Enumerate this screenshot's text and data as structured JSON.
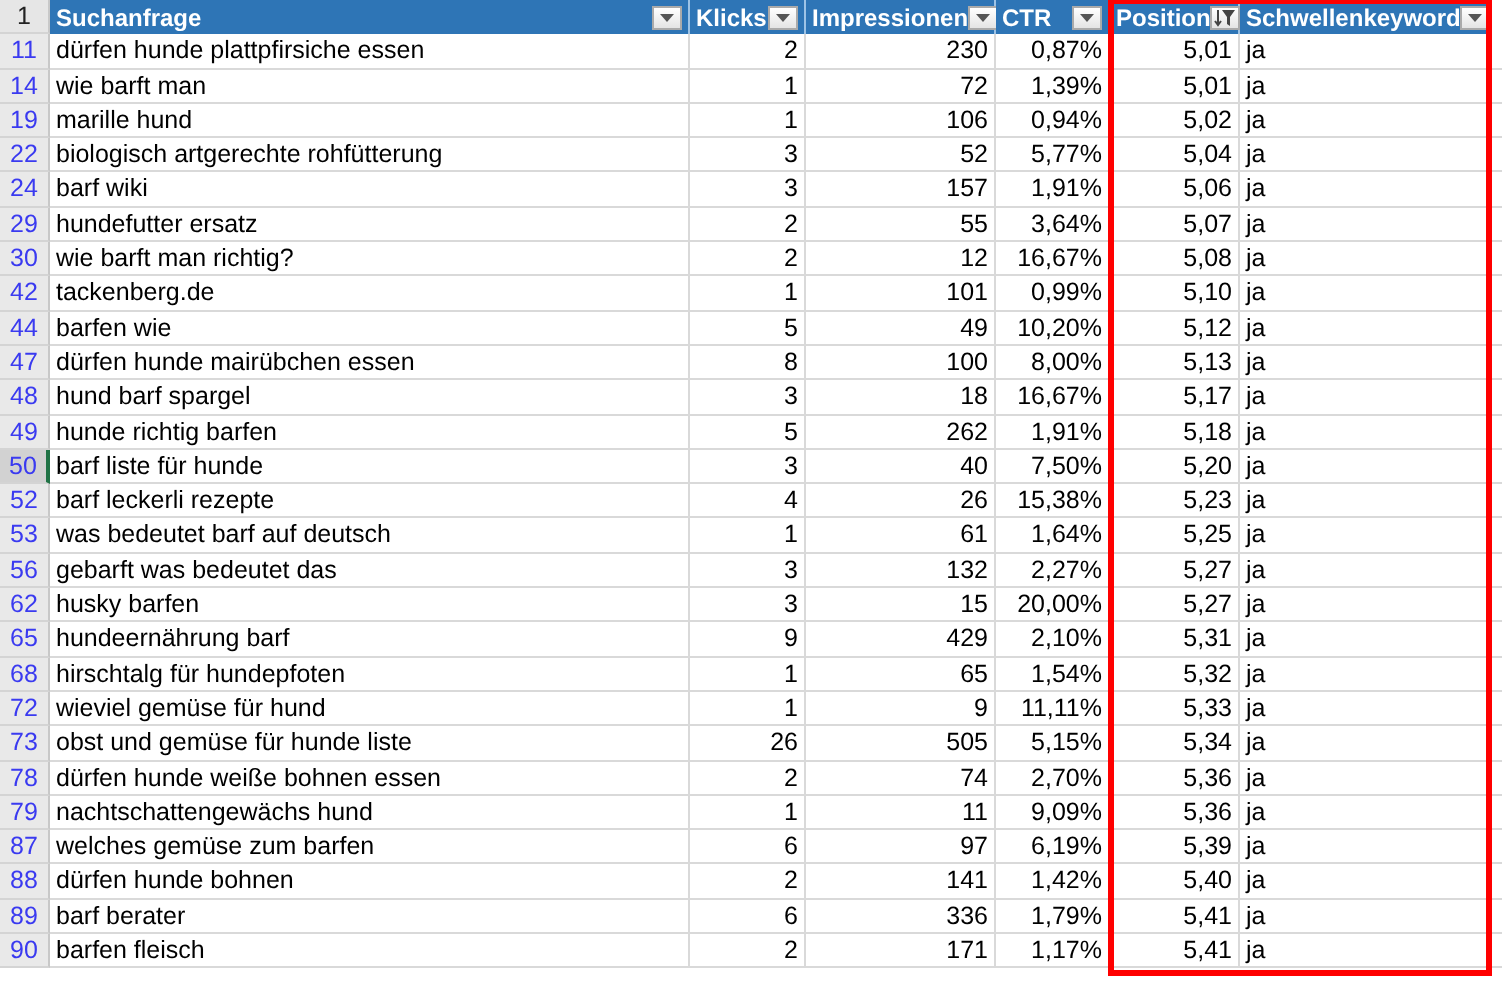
{
  "header_row_number": "1",
  "columns": [
    {
      "label": "Suchanfrage",
      "kind": "text",
      "filter_active": false,
      "highlighted": false
    },
    {
      "label": "Klicks",
      "kind": "number",
      "filter_active": false,
      "highlighted": false
    },
    {
      "label": "Impressionen",
      "kind": "number",
      "filter_active": false,
      "highlighted": false
    },
    {
      "label": "CTR",
      "kind": "number",
      "filter_active": false,
      "highlighted": false
    },
    {
      "label": "Position",
      "kind": "number",
      "filter_active": true,
      "highlighted": true
    },
    {
      "label": "Schwellenkeyword",
      "kind": "text",
      "filter_active": false,
      "highlighted": true
    }
  ],
  "rows": [
    {
      "number": "11",
      "selected": false,
      "cells": [
        "dürfen hunde plattpfirsiche essen",
        "2",
        "230",
        "0,87%",
        "5,01",
        "ja"
      ]
    },
    {
      "number": "14",
      "selected": false,
      "cells": [
        "wie barft man",
        "1",
        "72",
        "1,39%",
        "5,01",
        "ja"
      ]
    },
    {
      "number": "19",
      "selected": false,
      "cells": [
        "marille hund",
        "1",
        "106",
        "0,94%",
        "5,02",
        "ja"
      ]
    },
    {
      "number": "22",
      "selected": false,
      "cells": [
        "biologisch artgerechte rohfütterung",
        "3",
        "52",
        "5,77%",
        "5,04",
        "ja"
      ]
    },
    {
      "number": "24",
      "selected": false,
      "cells": [
        "barf wiki",
        "3",
        "157",
        "1,91%",
        "5,06",
        "ja"
      ]
    },
    {
      "number": "29",
      "selected": false,
      "cells": [
        "hundefutter ersatz",
        "2",
        "55",
        "3,64%",
        "5,07",
        "ja"
      ]
    },
    {
      "number": "30",
      "selected": false,
      "cells": [
        "wie barft man richtig?",
        "2",
        "12",
        "16,67%",
        "5,08",
        "ja"
      ]
    },
    {
      "number": "42",
      "selected": false,
      "cells": [
        "tackenberg.de",
        "1",
        "101",
        "0,99%",
        "5,10",
        "ja"
      ]
    },
    {
      "number": "44",
      "selected": false,
      "cells": [
        "barfen wie",
        "5",
        "49",
        "10,20%",
        "5,12",
        "ja"
      ]
    },
    {
      "number": "47",
      "selected": false,
      "cells": [
        "dürfen hunde mairübchen essen",
        "8",
        "100",
        "8,00%",
        "5,13",
        "ja"
      ]
    },
    {
      "number": "48",
      "selected": false,
      "cells": [
        "hund barf spargel",
        "3",
        "18",
        "16,67%",
        "5,17",
        "ja"
      ]
    },
    {
      "number": "49",
      "selected": false,
      "cells": [
        "hunde richtig barfen",
        "5",
        "262",
        "1,91%",
        "5,18",
        "ja"
      ]
    },
    {
      "number": "50",
      "selected": true,
      "cells": [
        "barf liste für hunde",
        "3",
        "40",
        "7,50%",
        "5,20",
        "ja"
      ]
    },
    {
      "number": "52",
      "selected": false,
      "cells": [
        "barf leckerli rezepte",
        "4",
        "26",
        "15,38%",
        "5,23",
        "ja"
      ]
    },
    {
      "number": "53",
      "selected": false,
      "cells": [
        "was bedeutet barf auf deutsch",
        "1",
        "61",
        "1,64%",
        "5,25",
        "ja"
      ]
    },
    {
      "number": "56",
      "selected": false,
      "cells": [
        "gebarft was bedeutet das",
        "3",
        "132",
        "2,27%",
        "5,27",
        "ja"
      ]
    },
    {
      "number": "62",
      "selected": false,
      "cells": [
        "husky barfen",
        "3",
        "15",
        "20,00%",
        "5,27",
        "ja"
      ]
    },
    {
      "number": "65",
      "selected": false,
      "cells": [
        "hundeernährung barf",
        "9",
        "429",
        "2,10%",
        "5,31",
        "ja"
      ]
    },
    {
      "number": "68",
      "selected": false,
      "cells": [
        "hirschtalg für hundepfoten",
        "1",
        "65",
        "1,54%",
        "5,32",
        "ja"
      ]
    },
    {
      "number": "72",
      "selected": false,
      "cells": [
        "wieviel gemüse für hund",
        "1",
        "9",
        "11,11%",
        "5,33",
        "ja"
      ]
    },
    {
      "number": "73",
      "selected": false,
      "cells": [
        "obst und gemüse für hunde liste",
        "26",
        "505",
        "5,15%",
        "5,34",
        "ja"
      ]
    },
    {
      "number": "78",
      "selected": false,
      "cells": [
        "dürfen hunde weiße bohnen essen",
        "2",
        "74",
        "2,70%",
        "5,36",
        "ja"
      ]
    },
    {
      "number": "79",
      "selected": false,
      "cells": [
        "nachtschattengewächs hund",
        "1",
        "11",
        "9,09%",
        "5,36",
        "ja"
      ]
    },
    {
      "number": "87",
      "selected": false,
      "cells": [
        "welches gemüse zum barfen",
        "6",
        "97",
        "6,19%",
        "5,39",
        "ja"
      ]
    },
    {
      "number": "88",
      "selected": false,
      "cells": [
        "dürfen hunde bohnen",
        "2",
        "141",
        "1,42%",
        "5,40",
        "ja"
      ]
    },
    {
      "number": "89",
      "selected": false,
      "cells": [
        "barf berater",
        "6",
        "336",
        "1,79%",
        "5,41",
        "ja"
      ]
    },
    {
      "number": "90",
      "selected": false,
      "cells": [
        "barfen fleisch",
        "2",
        "171",
        "1,17%",
        "5,41",
        "ja"
      ]
    }
  ]
}
